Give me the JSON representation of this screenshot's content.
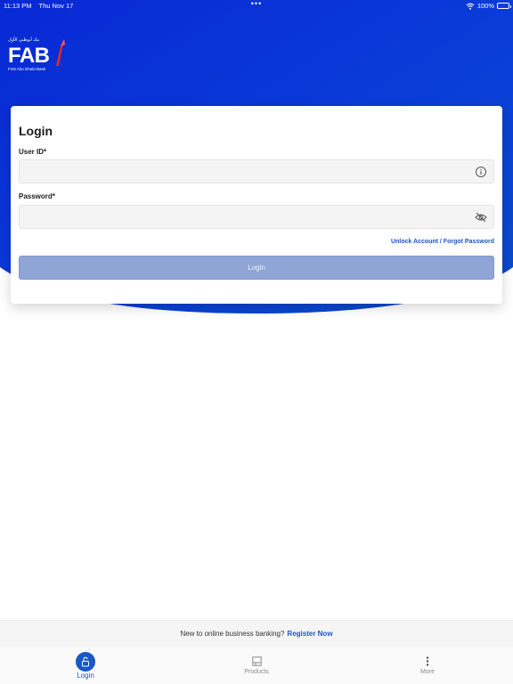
{
  "status_bar": {
    "time": "11:13 PM",
    "date": "Thu Nov 17",
    "battery": "100%"
  },
  "logo": {
    "arabic": "بنك أبوظبي الأول",
    "letters": "FAB",
    "subtitle": "First Abu Dhabi Bank"
  },
  "login_form": {
    "title": "Login",
    "user_id_label": "User ID*",
    "user_id_value": "",
    "password_label": "Password*",
    "password_value": "",
    "forgot_link": "Unlock Account / Forgot Password",
    "login_button": "Login"
  },
  "register": {
    "prompt": "New to online business banking?",
    "link": "Register Now"
  },
  "tabs": [
    {
      "label": "Login",
      "icon": "unlock-icon",
      "active": true
    },
    {
      "label": "Products",
      "icon": "products-icon",
      "active": false
    },
    {
      "label": "More",
      "icon": "more-vertical-icon",
      "active": false
    }
  ],
  "colors": {
    "brand_blue": "#1a56c4",
    "hero_top": "#0a2fd0",
    "hero_bottom": "#0040c8",
    "login_button_disabled": "#8ea5d6",
    "logo_red": "#e3262e"
  }
}
